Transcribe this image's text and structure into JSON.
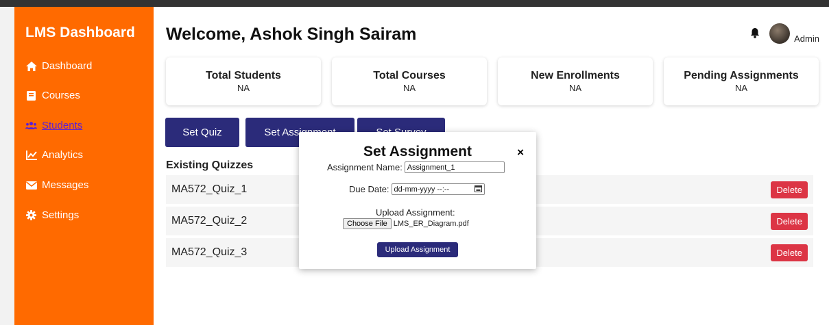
{
  "sidebar": {
    "title": "LMS Dashboard",
    "items": [
      {
        "label": "Dashboard",
        "icon": "home-icon"
      },
      {
        "label": "Courses",
        "icon": "book-icon"
      },
      {
        "label": "Students",
        "icon": "users-icon",
        "active": true
      },
      {
        "label": "Analytics",
        "icon": "chart-line-icon"
      },
      {
        "label": "Messages",
        "icon": "envelope-icon"
      },
      {
        "label": "Settings",
        "icon": "gear-icon"
      }
    ]
  },
  "header": {
    "welcome": "Welcome, Ashok Singh Sairam",
    "user_label": "Admin"
  },
  "stats": [
    {
      "label": "Total Students",
      "value": "NA"
    },
    {
      "label": "Total Courses",
      "value": "NA"
    },
    {
      "label": "New Enrollments",
      "value": "NA"
    },
    {
      "label": "Pending Assignments",
      "value": "NA"
    }
  ],
  "tabs": {
    "quiz": "Set Quiz",
    "assignment": "Set Assignment",
    "survey": "Set Survey"
  },
  "quizzes": {
    "title": "Existing Quizzes",
    "delete_label": "Delete",
    "items": [
      "MA572_Quiz_1",
      "MA572_Quiz_2",
      "MA572_Quiz_3"
    ]
  },
  "modal": {
    "title": "Set Assignment",
    "close": "×",
    "name_label": "Assignment Name:",
    "name_value": "Assignment_1",
    "due_label": "Due Date:",
    "due_value": "dd-mm-yyyy --:--",
    "upload_label": "Upload Assignment:",
    "choose_file": "Choose File",
    "file_name": "LMS_ER_Diagram.pdf",
    "submit": "Upload Assignment"
  },
  "colors": {
    "sidebar": "#ff6a00",
    "primary": "#2b2b7a",
    "danger": "#dc3545",
    "active_link": "#5a1fd6"
  }
}
